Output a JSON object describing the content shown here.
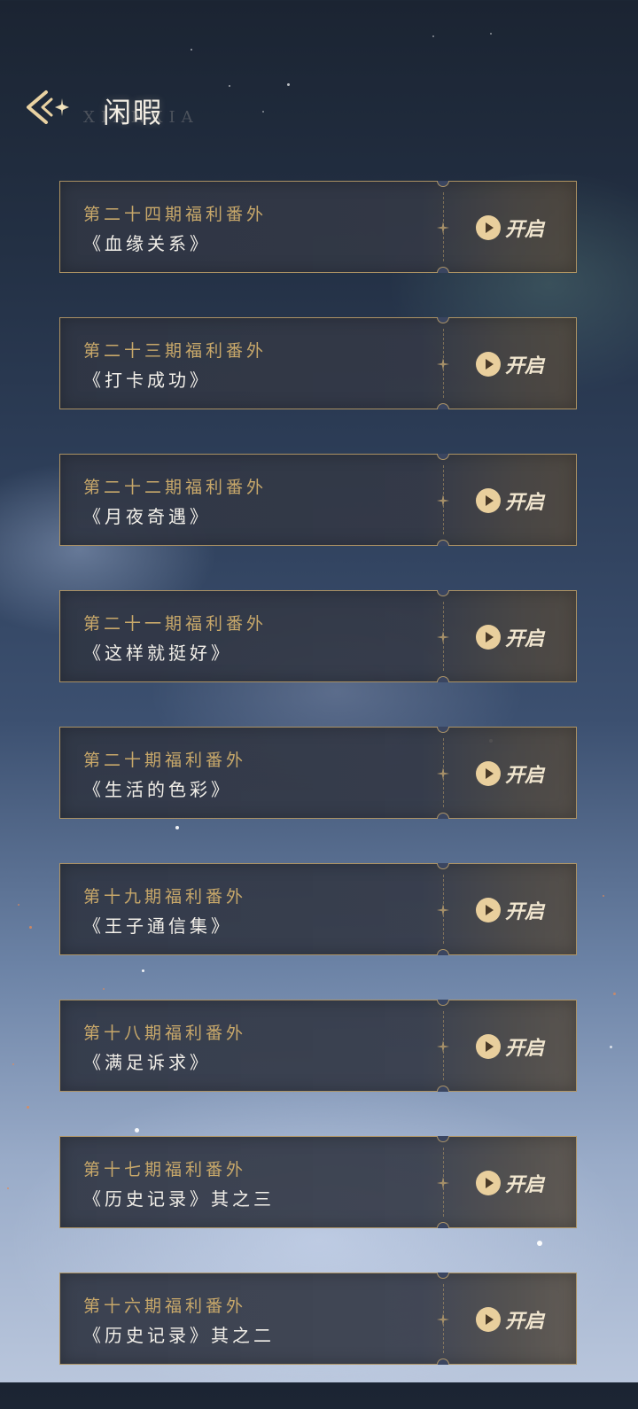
{
  "header": {
    "title": "闲暇",
    "subtitle": "XIANXIA",
    "back_icon": "back-arrow-icon"
  },
  "colors": {
    "accent_gold": "#c8a86a",
    "button_circle": "#e9cf9d",
    "card_border": "#c9a86a"
  },
  "items": [
    {
      "issue": "第二十四期福利番外",
      "name": "《血缘关系》",
      "button": "开启"
    },
    {
      "issue": "第二十三期福利番外",
      "name": "《打卡成功》",
      "button": "开启"
    },
    {
      "issue": "第二十二期福利番外",
      "name": "《月夜奇遇》",
      "button": "开启"
    },
    {
      "issue": "第二十一期福利番外",
      "name": "《这样就挺好》",
      "button": "开启"
    },
    {
      "issue": "第二十期福利番外",
      "name": "《生活的色彩》",
      "button": "开启"
    },
    {
      "issue": "第十九期福利番外",
      "name": "《王子通信集》",
      "button": "开启"
    },
    {
      "issue": "第十八期福利番外",
      "name": "《满足诉求》",
      "button": "开启"
    },
    {
      "issue": "第十七期福利番外",
      "name": "《历史记录》其之三",
      "button": "开启"
    },
    {
      "issue": "第十六期福利番外",
      "name": "《历史记录》其之二",
      "button": "开启"
    }
  ]
}
